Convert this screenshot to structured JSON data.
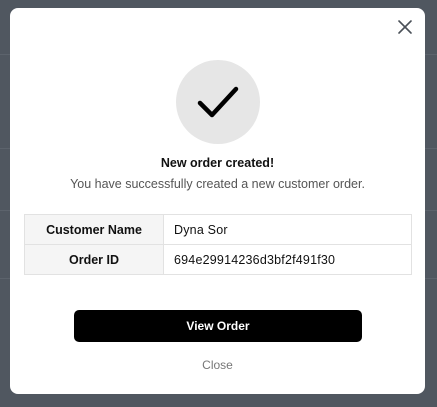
{
  "modal": {
    "title": "New order created!",
    "subtitle": "You have successfully created a new customer order.",
    "details": [
      {
        "label": "Customer Name",
        "value": "Dyna Sor"
      },
      {
        "label": "Order ID",
        "value": "694e29914236d3bf2f491f30"
      }
    ],
    "primary_button": "View Order",
    "close_link": "Close",
    "icons": {
      "close": "close-icon",
      "success": "checkmark-icon"
    }
  }
}
